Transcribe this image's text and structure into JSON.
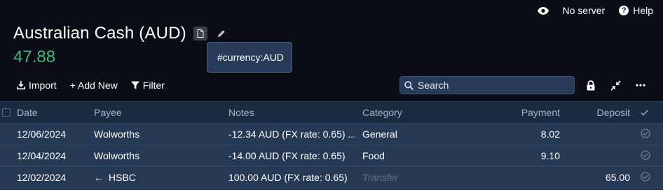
{
  "topbar": {
    "privacy_icon": "eye-icon",
    "server_label": "No server",
    "help_label": "Help"
  },
  "account": {
    "title": "Australian Cash (AUD)",
    "balance": "47.88",
    "note_tooltip": "#currency:AUD"
  },
  "toolbar": {
    "import_label": "Import",
    "add_label": "+ Add New",
    "filter_label": "Filter",
    "search_placeholder": "Search"
  },
  "table": {
    "headers": {
      "date": "Date",
      "payee": "Payee",
      "notes": "Notes",
      "category": "Category",
      "payment": "Payment",
      "deposit": "Deposit"
    },
    "rows": [
      {
        "date": "12/06/2024",
        "payee": "Wolworths",
        "notes": "-12.34 AUD (FX rate: 0.65) ...",
        "category": "General",
        "payment": "8.02",
        "deposit": ""
      },
      {
        "date": "12/04/2024",
        "payee": "Wolworths",
        "notes": "-14.00 AUD (FX rate: 0.65)",
        "category": "Food",
        "payment": "9.10",
        "deposit": ""
      },
      {
        "date": "12/02/2024",
        "payee": "HSBC",
        "payee_prefix": "←",
        "notes": "100.00 AUD (FX rate: 0.65)",
        "category": "Transfer",
        "payment": "",
        "deposit": "65.00"
      }
    ]
  },
  "colors": {
    "background": "#0b0c15",
    "balance": "#3fb979",
    "row": "#263a56",
    "header": "#1a2a40"
  }
}
